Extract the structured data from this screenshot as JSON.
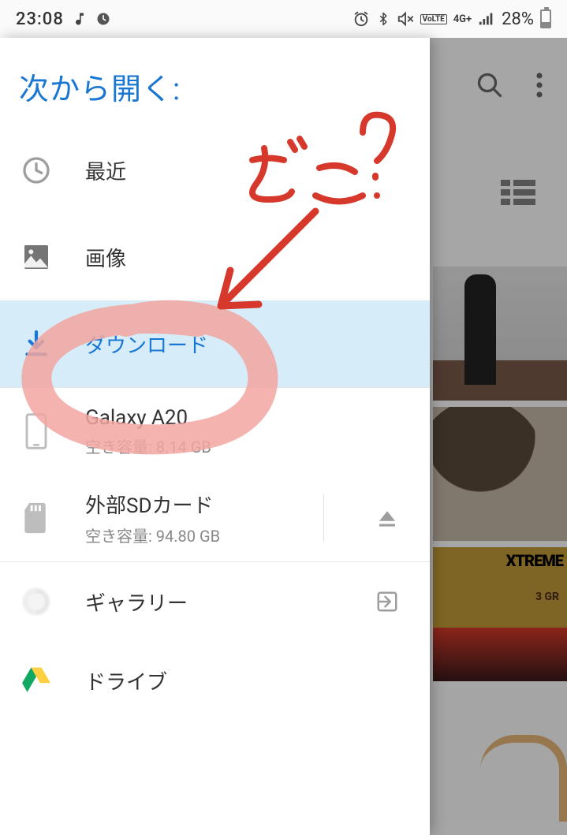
{
  "status": {
    "time": "23:08",
    "battery_pct": "28%",
    "network_label": "4G+",
    "volte_label": "VoLTE"
  },
  "drawer": {
    "title": "次から開く:",
    "items": [
      {
        "label": "最近"
      },
      {
        "label": "画像"
      },
      {
        "label": "ダウンロード"
      },
      {
        "label": "Galaxy A20",
        "sublabel": "空き容量: 8.14 GB"
      },
      {
        "label": "外部SDカード",
        "sublabel": "空き容量: 94.80 GB"
      },
      {
        "label": "ギャラリー"
      },
      {
        "label": "ドライブ"
      }
    ]
  },
  "annotation": {
    "text": "どこ？"
  },
  "background": {
    "thumb3_text": "XTREME",
    "thumb3_sub": "3 GR"
  }
}
